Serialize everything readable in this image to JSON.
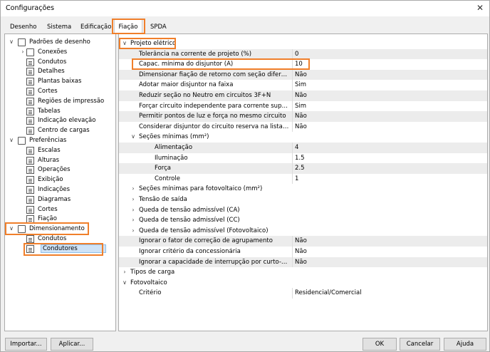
{
  "window": {
    "title": "Configurações",
    "close_glyph": "✕"
  },
  "tabs": [
    {
      "label": "Desenho"
    },
    {
      "label": "Sistema"
    },
    {
      "label": "Edificação"
    },
    {
      "label": "Fiação"
    },
    {
      "label": "SPDA"
    }
  ],
  "tree": [
    {
      "label": "Padrões de desenho",
      "level": 0,
      "chev": "∨",
      "icon": "folder"
    },
    {
      "label": "Conexões",
      "level": 1,
      "chev": "›",
      "icon": "folder"
    },
    {
      "label": "Condutos",
      "level": 1,
      "chev": "",
      "icon": "doc"
    },
    {
      "label": "Detalhes",
      "level": 1,
      "chev": "",
      "icon": "doc"
    },
    {
      "label": "Plantas baixas",
      "level": 1,
      "chev": "",
      "icon": "doc"
    },
    {
      "label": "Cortes",
      "level": 1,
      "chev": "",
      "icon": "doc"
    },
    {
      "label": "Regiões de impressão",
      "level": 1,
      "chev": "",
      "icon": "doc"
    },
    {
      "label": "Tabelas",
      "level": 1,
      "chev": "",
      "icon": "doc"
    },
    {
      "label": "Indicação elevação",
      "level": 1,
      "chev": "",
      "icon": "doc"
    },
    {
      "label": "Centro de cargas",
      "level": 1,
      "chev": "",
      "icon": "doc"
    },
    {
      "label": "Preferências",
      "level": 0,
      "chev": "∨",
      "icon": "folder"
    },
    {
      "label": "Escalas",
      "level": 1,
      "chev": "",
      "icon": "doc"
    },
    {
      "label": "Alturas",
      "level": 1,
      "chev": "",
      "icon": "doc"
    },
    {
      "label": "Operações",
      "level": 1,
      "chev": "",
      "icon": "doc"
    },
    {
      "label": "Exibição",
      "level": 1,
      "chev": "",
      "icon": "doc"
    },
    {
      "label": "Indicações",
      "level": 1,
      "chev": "",
      "icon": "doc"
    },
    {
      "label": "Diagramas",
      "level": 1,
      "chev": "",
      "icon": "doc"
    },
    {
      "label": "Cortes",
      "level": 1,
      "chev": "",
      "icon": "doc"
    },
    {
      "label": "Fiação",
      "level": 1,
      "chev": "",
      "icon": "doc"
    },
    {
      "label": "Dimensionamento",
      "level": 0,
      "chev": "∨",
      "icon": "folder"
    },
    {
      "label": "Condutos",
      "level": 1,
      "chev": "",
      "icon": "doc"
    },
    {
      "label": "Condutores",
      "level": 1,
      "chev": "",
      "icon": "doc",
      "selected": true
    }
  ],
  "props": [
    {
      "type": "section",
      "name": "Projeto elétrico",
      "chev": "∨",
      "indent": 0
    },
    {
      "name": "Tolerância na corrente de projeto (%)",
      "value": "0",
      "indent": 1
    },
    {
      "name": "Capac. mínima do disjuntor (A)",
      "value": "10",
      "indent": 1
    },
    {
      "name": "Dimensionar fiação de retorno com seção diferente...",
      "value": "Não",
      "indent": 1
    },
    {
      "name": "Adotar maior disjuntor na faixa",
      "value": "Sim",
      "indent": 1
    },
    {
      "name": "Reduzir seção no Neutro em circuitos 3F+N",
      "value": "Não",
      "indent": 1
    },
    {
      "name": "Forçar circuito independente para corrente superior...",
      "value": "Sim",
      "indent": 1
    },
    {
      "name": "Permitir pontos de luz e força no mesmo circuito",
      "value": "Não",
      "indent": 1
    },
    {
      "name": "Considerar disjuntor do circuito reserva na lista de ...",
      "value": "Não",
      "indent": 1
    },
    {
      "type": "group",
      "name": "Seções mínimas (mm²)",
      "chev": "∨",
      "indent": 1
    },
    {
      "name": "Alimentação",
      "value": "4",
      "indent": 2
    },
    {
      "name": "Iluminação",
      "value": "1.5",
      "indent": 2
    },
    {
      "name": "Força",
      "value": "2.5",
      "indent": 2
    },
    {
      "name": "Controle",
      "value": "1",
      "indent": 2
    },
    {
      "type": "group",
      "name": "Seções mínimas para fotovoltaico (mm²)",
      "chev": "›",
      "indent": 1
    },
    {
      "type": "group",
      "name": "Tensão de saída",
      "chev": "›",
      "indent": 1
    },
    {
      "type": "group",
      "name": "Queda de tensão admissível (CA)",
      "chev": "›",
      "indent": 1
    },
    {
      "type": "group",
      "name": "Queda de tensão admissível (CC)",
      "chev": "›",
      "indent": 1
    },
    {
      "type": "group",
      "name": "Queda de tensão admissível (Fotovoltaico)",
      "chev": "›",
      "indent": 1
    },
    {
      "name": "Ignorar o fator de correção de agrupamento",
      "value": "Não",
      "indent": 1
    },
    {
      "name": "Ignorar critério da concessionária",
      "value": "Não",
      "indent": 1
    },
    {
      "name": "Ignorar a capacidade de interrupção por curto-circ...",
      "value": "Não",
      "indent": 1
    },
    {
      "type": "section",
      "name": "Tipos de carga",
      "chev": "›",
      "indent": 0
    },
    {
      "type": "section",
      "name": "Fotovoltaico",
      "chev": "∨",
      "indent": 0
    },
    {
      "name": "Critério",
      "value": "Residencial/Comercial",
      "indent": 1
    }
  ],
  "buttons": {
    "import": "Importar...",
    "apply": "Aplicar...",
    "ok": "OK",
    "cancel": "Cancelar",
    "help": "Ajuda"
  },
  "colors": {
    "highlight": "#f07f2b",
    "selection": "#cfe3f7"
  }
}
